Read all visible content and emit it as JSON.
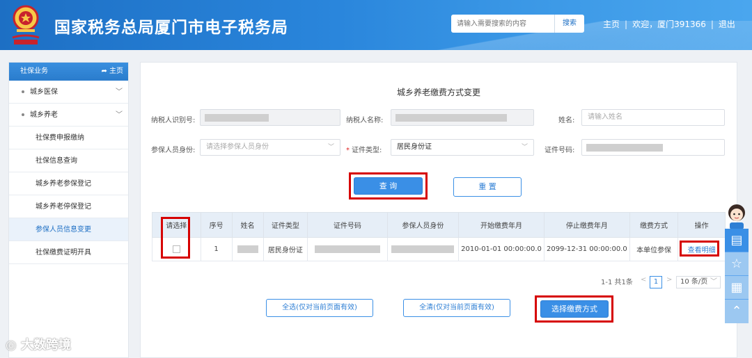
{
  "header": {
    "title": "国家税务总局厦门市电子税务局",
    "search_placeholder": "请输入需要搜索的内容",
    "search_button": "搜索",
    "nav_home": "主页",
    "nav_welcome": "欢迎，厦门391366",
    "nav_logout": "退出",
    "sep": "|"
  },
  "sidebar": {
    "title": "社保业务",
    "home_label": "主页",
    "groups": [
      {
        "label": "城乡医保"
      },
      {
        "label": "城乡养老"
      }
    ],
    "items": [
      {
        "label": "社保费申报缴纳"
      },
      {
        "label": "社保信息查询"
      },
      {
        "label": "城乡养老参保登记"
      },
      {
        "label": "城乡养老停保登记"
      },
      {
        "label": "参保人员信息变更"
      },
      {
        "label": "社保缴费证明开具"
      }
    ]
  },
  "form": {
    "title": "城乡养老缴费方式变更",
    "taxpayer_id_label": "纳税人识别号:",
    "taxpayer_name_label": "纳税人名称:",
    "name_label": "姓名:",
    "name_placeholder": "请输入姓名",
    "identity_label": "参保人员身份:",
    "identity_placeholder": "请选择参保人员身份",
    "id_type_required": "*",
    "id_type_label": "证件类型:",
    "id_type_value": "居民身份证",
    "id_number_label": "证件号码:",
    "query_button": "查 询",
    "reset_button": "重 置"
  },
  "table": {
    "headers": [
      "请选择",
      "序号",
      "姓名",
      "证件类型",
      "证件号码",
      "参保人员身份",
      "开始缴费年月",
      "停止缴费年月",
      "缴费方式",
      "操作"
    ],
    "rows": [
      {
        "index": "1",
        "id_type": "居民身份证",
        "start": "2010-01-01 00:00:00.0",
        "end": "2099-12-31 00:00:00.0",
        "method": "本单位参保",
        "action": "查看明细"
      }
    ]
  },
  "pagination": {
    "summary": "1-1 共1条",
    "prev": "<",
    "current_page": "1",
    "next": ">",
    "page_size": "10 条/页"
  },
  "actions": {
    "select_all": "全选(仅对当前页面有效)",
    "clear_all": "全清(仅对当前页面有效)",
    "choose_method": "选择缴费方式"
  },
  "watermark": "大数跨境",
  "colors": {
    "header_blue": "#2a86dc",
    "accent": "#3a8fe6",
    "highlight_red": "#d60000"
  }
}
